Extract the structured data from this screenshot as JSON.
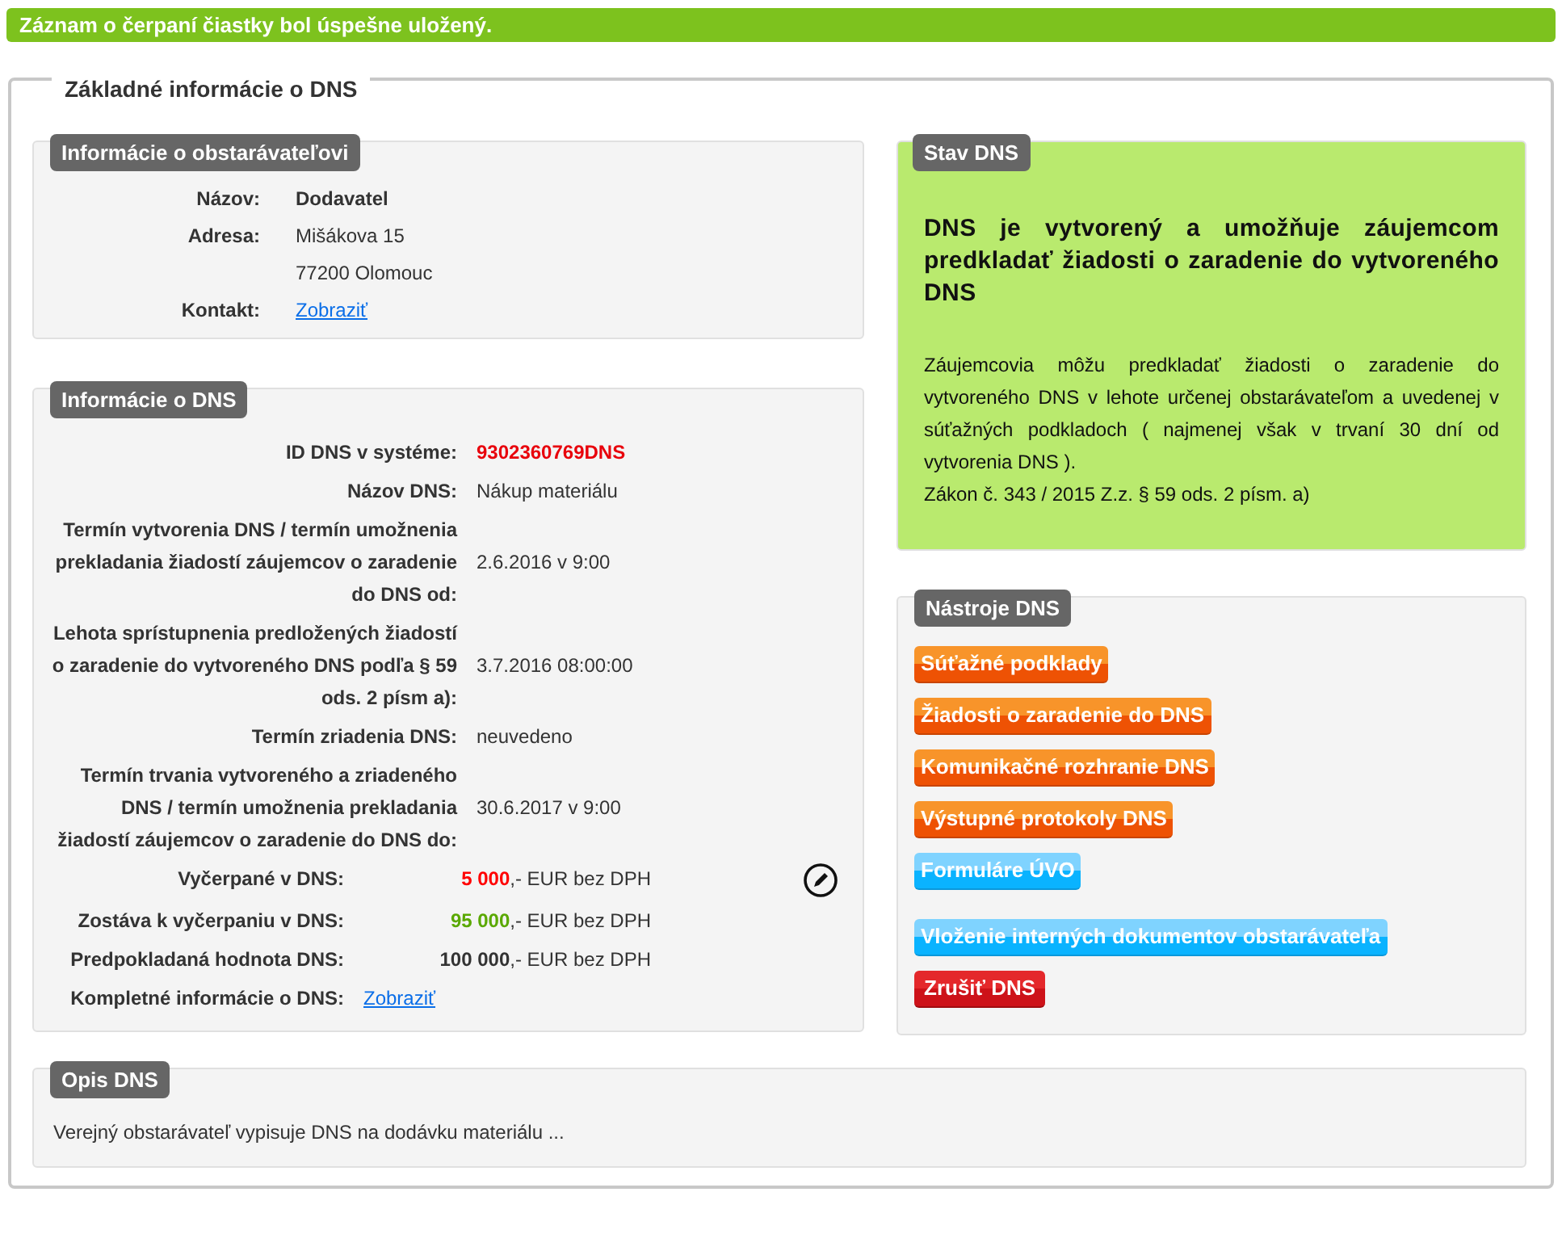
{
  "banner": "Záznam o čerpaní čiastky bol úspešne uložený.",
  "section_title": "Základné informácie o DNS",
  "procurer": {
    "title": "Informácie o obstarávateľovi",
    "rows": [
      {
        "label": "Názov:",
        "value": "Dodavatel",
        "kind": "bold"
      },
      {
        "label": "Adresa:",
        "value": "Mišákova 15",
        "kind": "text"
      },
      {
        "value": "77200 Olomouc",
        "kind": "text"
      },
      {
        "label": "Kontakt:",
        "value": "Zobraziť",
        "kind": "link"
      }
    ]
  },
  "dns_info": {
    "title": "Informácie o DNS",
    "rows": [
      {
        "label": "ID DNS v systéme:",
        "value": "9302360769DNS",
        "kind": "id"
      },
      {
        "label": "Názov DNS:",
        "value": "Nákup materiálu",
        "kind": "text"
      },
      {
        "label": "Termín vytvorenia DNS / termín umožnenia prekladania žiadostí záujemcov o zaradenie do DNS od:",
        "value": "2.6.2016 v 9:00",
        "kind": "text"
      },
      {
        "label": "Lehota sprístupnenia predložených žiadostí o zaradenie do vytvoreného DNS podľa § 59 ods. 2 písm a):",
        "value": "3.7.2016 08:00:00",
        "kind": "text"
      },
      {
        "label": "Termín zriadenia DNS:",
        "value": "neuvedeno",
        "kind": "text"
      },
      {
        "label": "Termín trvania vytvoreného a zriadeného DNS / termín umožnenia prekladania žiadostí záujemcov o zaradenie do DNS do:",
        "value": "30.6.2017 v 9:00",
        "kind": "text"
      }
    ],
    "amounts": [
      {
        "label": "Vyčerpané v DNS:",
        "amount": "5 000",
        "suffix": ",- EUR bez DPH",
        "color": "#ff0000",
        "editable": true
      },
      {
        "label": "Zostáva k vyčerpaniu v DNS:",
        "amount": "95 000",
        "suffix": ",- EUR bez DPH",
        "color": "#5aa800",
        "editable": false
      },
      {
        "label": "Predpokladaná hodnota DNS:",
        "amount": "100 000",
        "suffix": ",- EUR bez DPH",
        "color": "#333333",
        "editable": false
      }
    ],
    "more": {
      "label": "Kompletné informácie o DNS:",
      "link": "Zobraziť"
    }
  },
  "status": {
    "title": "Stav DNS",
    "headline": "DNS je vytvorený a umožňuje záujemcom predkladať žiadosti o zaradenie do vytvoreného DNS",
    "text": "Záujemcovia môžu predkladať žiadosti o zaradenie do vytvoreného DNS v lehote určenej obstarávateľom a uvedenej v súťažných podkladoch ( najmenej však v trvaní 30 dní od vytvorenia DNS ).",
    "law": "Zákon č. 343 / 2015 Z.z. § 59 ods. 2 písm. a)"
  },
  "tools": {
    "title": "Nástroje DNS",
    "groups": [
      {
        "buttons": [
          {
            "label": "Súťažné podklady",
            "kind": "orange"
          },
          {
            "label": "Žiadosti o zaradenie do DNS",
            "kind": "orange"
          },
          {
            "label": "Komunikačné rozhranie DNS",
            "kind": "orange"
          },
          {
            "label": "Výstupné protokoly DNS",
            "kind": "orange"
          },
          {
            "label": "Formuláre ÚVO",
            "kind": "blue"
          }
        ]
      },
      {
        "buttons": [
          {
            "label": "Vloženie interných dokumentov obstarávateľa",
            "kind": "blue"
          },
          {
            "label": "Zrušiť DNS",
            "kind": "red"
          }
        ]
      }
    ]
  },
  "description": {
    "title": "Opis DNS",
    "text": "Verejný obstarávateľ vypisuje DNS na dodávku materiálu ..."
  }
}
